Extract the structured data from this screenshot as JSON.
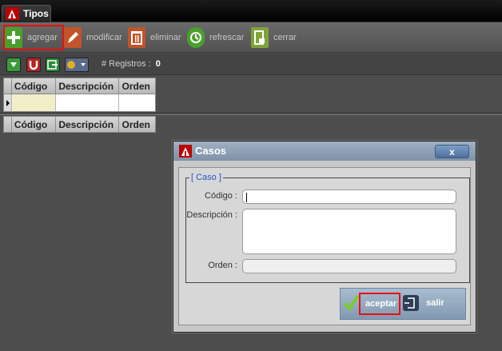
{
  "window": {
    "tab_title": "Tipos"
  },
  "toolbar": {
    "agregar": "agregar",
    "modificar": "modificar",
    "eliminar": "eliminar",
    "refrescar": "refrescar",
    "cerrar": "cerrar"
  },
  "subtoolbar": {
    "registros_label": "# Registros :",
    "registros_count": "0"
  },
  "grid_top": {
    "columns": [
      "Código",
      "Descripción",
      "Orden"
    ]
  },
  "grid_bottom": {
    "columns": [
      "Código",
      "Descripción",
      "Orden"
    ]
  },
  "dialog": {
    "title": "Casos",
    "close_label": "x",
    "legend": "[ Caso ]",
    "codigo_label": "Código :",
    "codigo_value": "",
    "descripcion_label": "Descripción :",
    "descripcion_value": "",
    "orden_label": "Orden :",
    "orden_value": "",
    "aceptar": "aceptar",
    "salir": "salir"
  },
  "colors": {
    "highlight": "#e81010",
    "legend": "#2059c8",
    "green": "#4aa02c"
  }
}
